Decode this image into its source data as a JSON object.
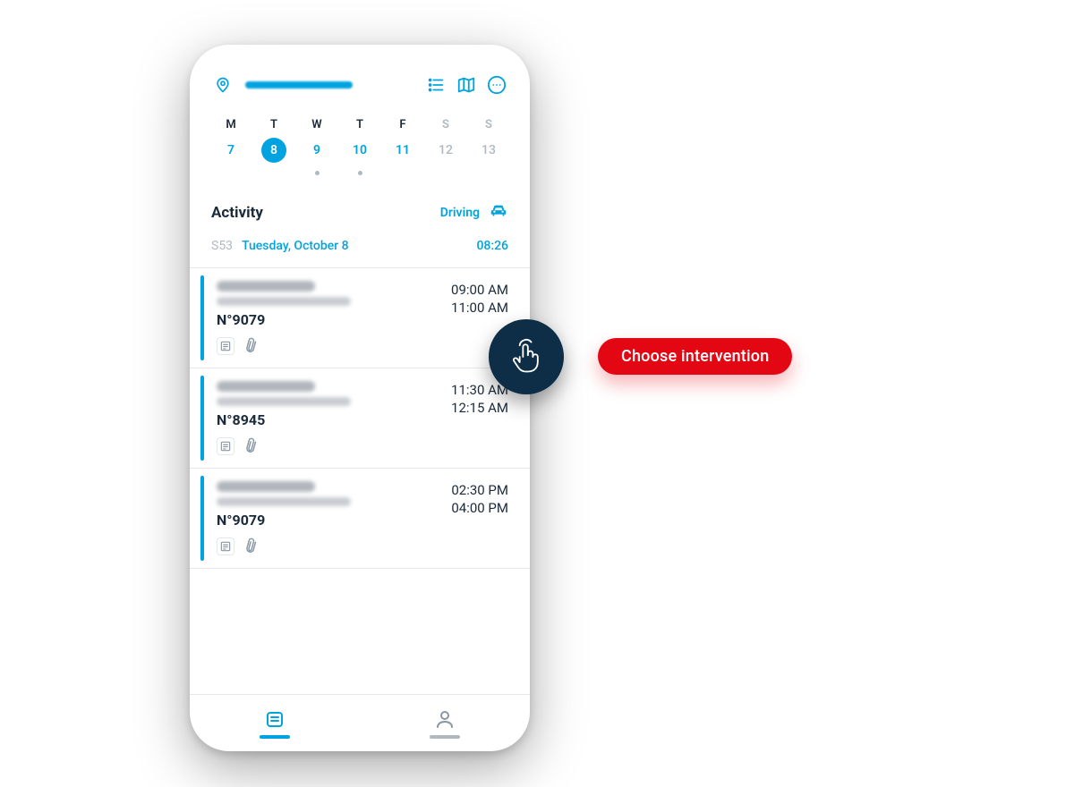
{
  "colors": {
    "accent": "#00a3e0",
    "dark_navy": "#0e2e47",
    "red": "#e30613"
  },
  "topbar": {
    "icons": {
      "pin": "location-pin-icon",
      "list": "list-icon",
      "map": "map-icon",
      "more": "more-circle-icon"
    }
  },
  "week": {
    "days": [
      {
        "dow": "M",
        "num": "7",
        "weekend": false,
        "selected": false,
        "dot": false
      },
      {
        "dow": "T",
        "num": "8",
        "weekend": false,
        "selected": true,
        "dot": false
      },
      {
        "dow": "W",
        "num": "9",
        "weekend": false,
        "selected": false,
        "dot": true
      },
      {
        "dow": "T",
        "num": "10",
        "weekend": false,
        "selected": false,
        "dot": true
      },
      {
        "dow": "F",
        "num": "11",
        "weekend": false,
        "selected": false,
        "dot": false
      },
      {
        "dow": "S",
        "num": "12",
        "weekend": true,
        "selected": false,
        "dot": false
      },
      {
        "dow": "S",
        "num": "13",
        "weekend": true,
        "selected": false,
        "dot": false
      }
    ]
  },
  "activity": {
    "title": "Activity",
    "status_label": "Driving",
    "status_icon": "car-icon"
  },
  "date_row": {
    "week_label": "S53",
    "date_label": "Tuesday, October 8",
    "time_label": "08:26"
  },
  "items": [
    {
      "number": "N°9079",
      "start": "09:00 AM",
      "end": "11:00 AM"
    },
    {
      "number": "N°8945",
      "start": "11:30 AM",
      "end": "12:15 AM"
    },
    {
      "number": "N°9079",
      "start": "02:30 PM",
      "end": "04:00 PM"
    }
  ],
  "bottom_nav": {
    "agenda_icon": "agenda-icon",
    "profile_icon": "profile-icon"
  },
  "callout": {
    "label": "Choose intervention"
  }
}
